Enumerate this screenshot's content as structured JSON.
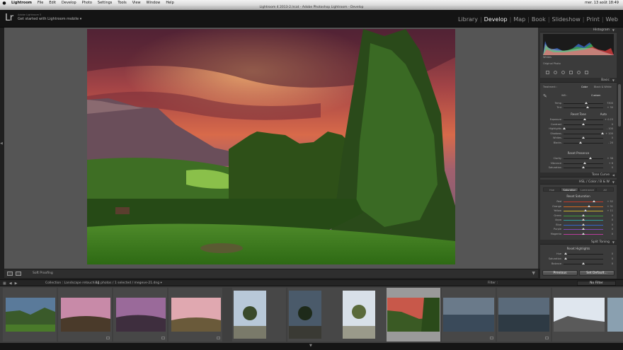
{
  "menubar": {
    "apple": "",
    "items": [
      "Lightroom",
      "File",
      "Edit",
      "Develop",
      "Photo",
      "Settings",
      "Tools",
      "View",
      "Window",
      "Help"
    ],
    "right_status": "mer. 13 août 18:49"
  },
  "window_title": "Lightroom 4 2013-2.lrcat - Adobe Photoshop Lightroom - Develop",
  "identity": {
    "logo": "Lr",
    "small": "Adobe Lightroom 5",
    "text": "Get started with Lightroom mobile ▾"
  },
  "modules": [
    "Library",
    "Develop",
    "Map",
    "Book",
    "Slideshow",
    "Print",
    "Web"
  ],
  "active_module": "Develop",
  "right_panel": {
    "histogram_label": "Histogram",
    "whites_label": "Whites",
    "original_photo": "Original Photo",
    "basic_label": "Basic",
    "treatment": "Treatment :",
    "color": "Color",
    "bw": "Black & White",
    "wb_label": "WB :",
    "wb_value": "Custom",
    "tone_label": "Reset Tone",
    "tone_auto": "Auto",
    "presence_label": "Reset Presence",
    "tone_curve": "Tone Curve",
    "hsl_label": "HSL / Color / B & W",
    "hsl_tabs": [
      "Hue",
      "Saturation",
      "Luminance",
      "All"
    ],
    "hsl_active_tab": "Saturation",
    "reset_saturation": "Reset Saturation",
    "split_toning": "Split Toning",
    "reset_highlights": "Reset Highlights",
    "previous": "Previous",
    "set_default": "Set Default..."
  },
  "sliders_basic": [
    {
      "label": "Temp",
      "value": "7300",
      "pos": 0.58
    },
    {
      "label": "Tint",
      "value": "+ 30",
      "pos": 0.6
    }
  ],
  "sliders_tone": [
    {
      "label": "Exposure",
      "value": "+ 0.23",
      "pos": 0.53
    },
    {
      "label": "Contrast",
      "value": "0",
      "pos": 0.5
    },
    {
      "label": "Highlights",
      "value": "- 100",
      "pos": 0.02
    },
    {
      "label": "Shadows",
      "value": "+ 100",
      "pos": 0.98
    },
    {
      "label": "Whites",
      "value": "0",
      "pos": 0.5
    },
    {
      "label": "Blacks",
      "value": "- 20",
      "pos": 0.42
    }
  ],
  "sliders_presence": [
    {
      "label": "Clarity",
      "value": "+ 38",
      "pos": 0.68
    },
    {
      "label": "Vibrance",
      "value": "+ 6",
      "pos": 0.53
    },
    {
      "label": "Saturation",
      "value": "0",
      "pos": 0.5
    }
  ],
  "sliders_hsl": [
    {
      "label": "Red",
      "value": "+ 52",
      "pos": 0.76,
      "color": "#c0392b"
    },
    {
      "label": "Orange",
      "value": "+ 31",
      "pos": 0.65,
      "color": "#d2691e"
    },
    {
      "label": "Yellow",
      "value": "+ 11",
      "pos": 0.56,
      "color": "#c8b22d"
    },
    {
      "label": "Green",
      "value": "0",
      "pos": 0.5,
      "color": "#3e9b3e"
    },
    {
      "label": "Aqua",
      "value": "0",
      "pos": 0.5,
      "color": "#2ea0a0"
    },
    {
      "label": "Blue",
      "value": "0",
      "pos": 0.5,
      "color": "#3465c8"
    },
    {
      "label": "Purple",
      "value": "0",
      "pos": 0.5,
      "color": "#7e49b8"
    },
    {
      "label": "Magenta",
      "value": "0",
      "pos": 0.5,
      "color": "#b83c9b"
    }
  ],
  "sliders_split": [
    {
      "label": "Hue",
      "value": "0",
      "pos": 0.05
    },
    {
      "label": "Saturation",
      "value": "0",
      "pos": 0.05
    },
    {
      "label": "Balance",
      "value": "0",
      "pos": 0.5
    }
  ],
  "toolbar": {
    "soft_proofing": "Soft Proofing"
  },
  "filmstrip_header": {
    "source": "Collection : Landscape retouching",
    "count": "11 photos / 1 selected / megeve-21.dng ▾",
    "filter": "Filter :",
    "no_filter": "No Filter"
  },
  "colors": {
    "panel_bg": "#3b3b3b",
    "center_bg": "#555555",
    "active_module": "#f0f0f0"
  }
}
